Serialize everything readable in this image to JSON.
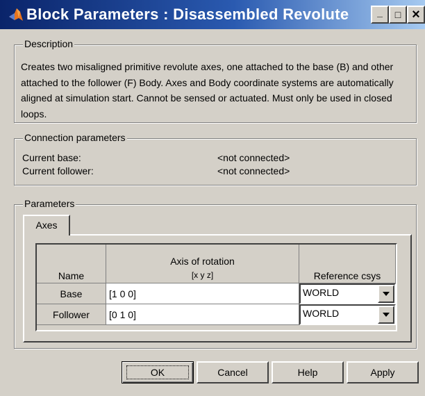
{
  "window": {
    "title": "Block Parameters : Disassembled Revolute",
    "controls": {
      "minimize": "_",
      "maximize": "□",
      "close": "×"
    },
    "icon": "matlab-logo-icon"
  },
  "description": {
    "legend": "Description",
    "text": "Creates two misaligned primitive revolute axes, one attached to the base (B) and other attached to the follower (F) Body. Axes and Body coordinate systems are automatically aligned at simulation start. Cannot be sensed or actuated. Must only be used in closed loops."
  },
  "connection": {
    "legend": "Connection parameters",
    "base_label": "Current base:",
    "base_value": "<not connected>",
    "follower_label": "Current follower:",
    "follower_value": "<not connected>"
  },
  "parameters": {
    "legend": "Parameters",
    "tabs": [
      {
        "label": "Axes"
      }
    ],
    "table": {
      "headers": {
        "name": "Name",
        "axis": "Axis of rotation",
        "axis_sub": "[x y z]",
        "ref": "Reference csys"
      },
      "rows": [
        {
          "name": "Base",
          "axis": "[1 0 0]",
          "ref": "WORLD"
        },
        {
          "name": "Follower",
          "axis": "[0 1 0]",
          "ref": "WORLD"
        }
      ]
    }
  },
  "buttons": {
    "ok": "OK",
    "cancel": "Cancel",
    "help": "Help",
    "apply": "Apply"
  }
}
